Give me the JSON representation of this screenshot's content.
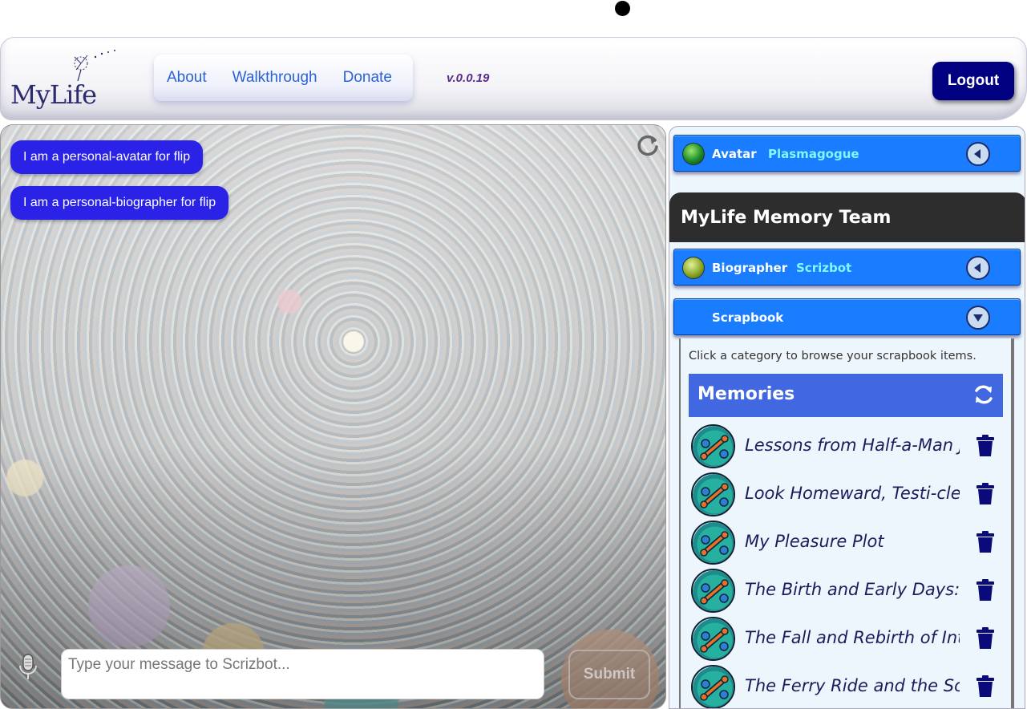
{
  "header": {
    "logo_text": "MyLife",
    "nav": [
      "About",
      "Walkthrough",
      "Donate"
    ],
    "version": "v.0.0.19",
    "logout_label": "Logout"
  },
  "chat": {
    "messages": [
      "I am a personal-avatar for flip",
      "I am a personal-biographer for flip"
    ],
    "input_placeholder": "Type your message to Scrizbot...",
    "submit_label": "Submit"
  },
  "sidebar": {
    "avatar": {
      "role": "Avatar",
      "name": "Plasmagogue"
    },
    "team_title": "MyLife Memory Team",
    "biographer": {
      "role": "Biographer",
      "name": "Scrizbot"
    },
    "scrapbook": {
      "label": "Scrapbook",
      "hint": "Click a category to browse your scrapbook items.",
      "category": "Memories",
      "items": [
        "Lessons from Half-a-Man Joe",
        "Look Homeward, Testi-cles!",
        "My Pleasure Plot",
        "The Birth and Early Days: Do",
        "The Fall and Rebirth of Intell",
        "The Ferry Ride and the Soup"
      ]
    }
  },
  "colors": {
    "accent_blue": "#1a7dff",
    "logout_bg": "#000080",
    "message_bubble": "#2a22e6",
    "memories_header": "#4168e0",
    "agent_name": "#7ff8ff"
  }
}
